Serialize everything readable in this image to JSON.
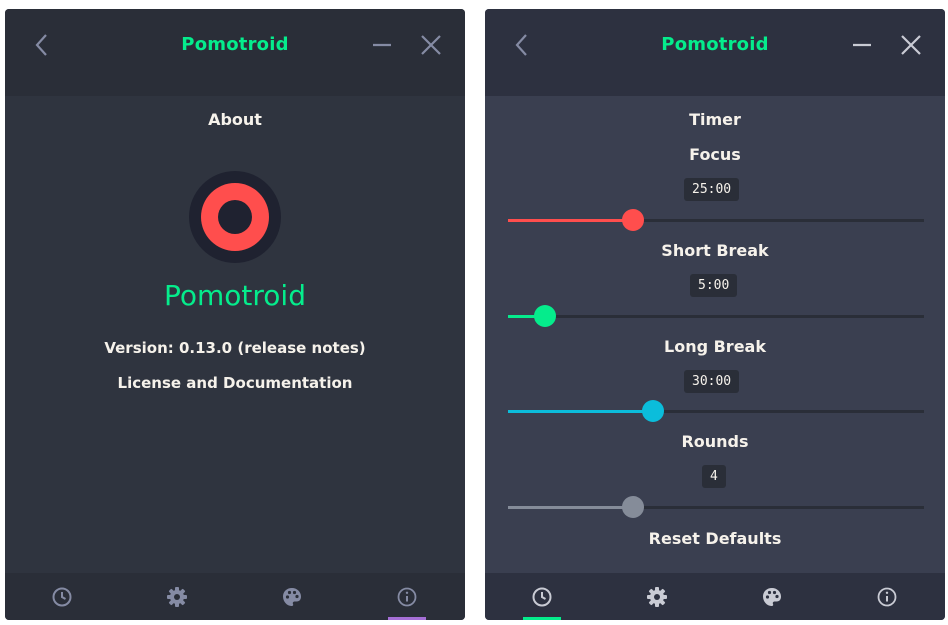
{
  "colors": {
    "accent_green": "#05ec8c",
    "focus_red": "#ff4e4d",
    "long_break_blue": "#0bbddb",
    "rounds_grey": "#858c99",
    "nav_indicator_purple": "#a56fd6",
    "nav_indicator_green": "#05ec8c",
    "nav_icon": "#858ba4"
  },
  "windows": [
    {
      "title": "Pomotroid",
      "panel": "about",
      "about": {
        "heading": "About",
        "app_name": "Pomotroid",
        "version_prefix": "Version: 0.13.0 (",
        "release_notes": "release notes",
        "version_suffix": ")",
        "license": "License and Documentation"
      },
      "nav": [
        {
          "icon": "clock-icon",
          "active": false
        },
        {
          "icon": "gear-icon",
          "active": false
        },
        {
          "icon": "palette-icon",
          "active": false
        },
        {
          "icon": "info-icon",
          "active": true
        }
      ]
    },
    {
      "title": "Pomotroid",
      "panel": "timer",
      "timer": {
        "heading": "Timer",
        "focus": {
          "label": "Focus",
          "value": "25:00",
          "minutes": 25,
          "max": 90,
          "slider_fraction": 0.29
        },
        "short_break": {
          "label": "Short Break",
          "value": "5:00",
          "minutes": 5,
          "max": 90,
          "slider_fraction": 0.08
        },
        "long_break": {
          "label": "Long Break",
          "value": "30:00",
          "minutes": 30,
          "max": 90,
          "slider_fraction": 0.34
        },
        "rounds": {
          "label": "Rounds",
          "value": "4",
          "count": 4,
          "max": 12,
          "slider_fraction": 0.29
        },
        "reset": "Reset Defaults"
      },
      "nav": [
        {
          "icon": "clock-icon",
          "active": true
        },
        {
          "icon": "gear-icon",
          "active": false
        },
        {
          "icon": "palette-icon",
          "active": false
        },
        {
          "icon": "info-icon",
          "active": false
        }
      ]
    }
  ]
}
